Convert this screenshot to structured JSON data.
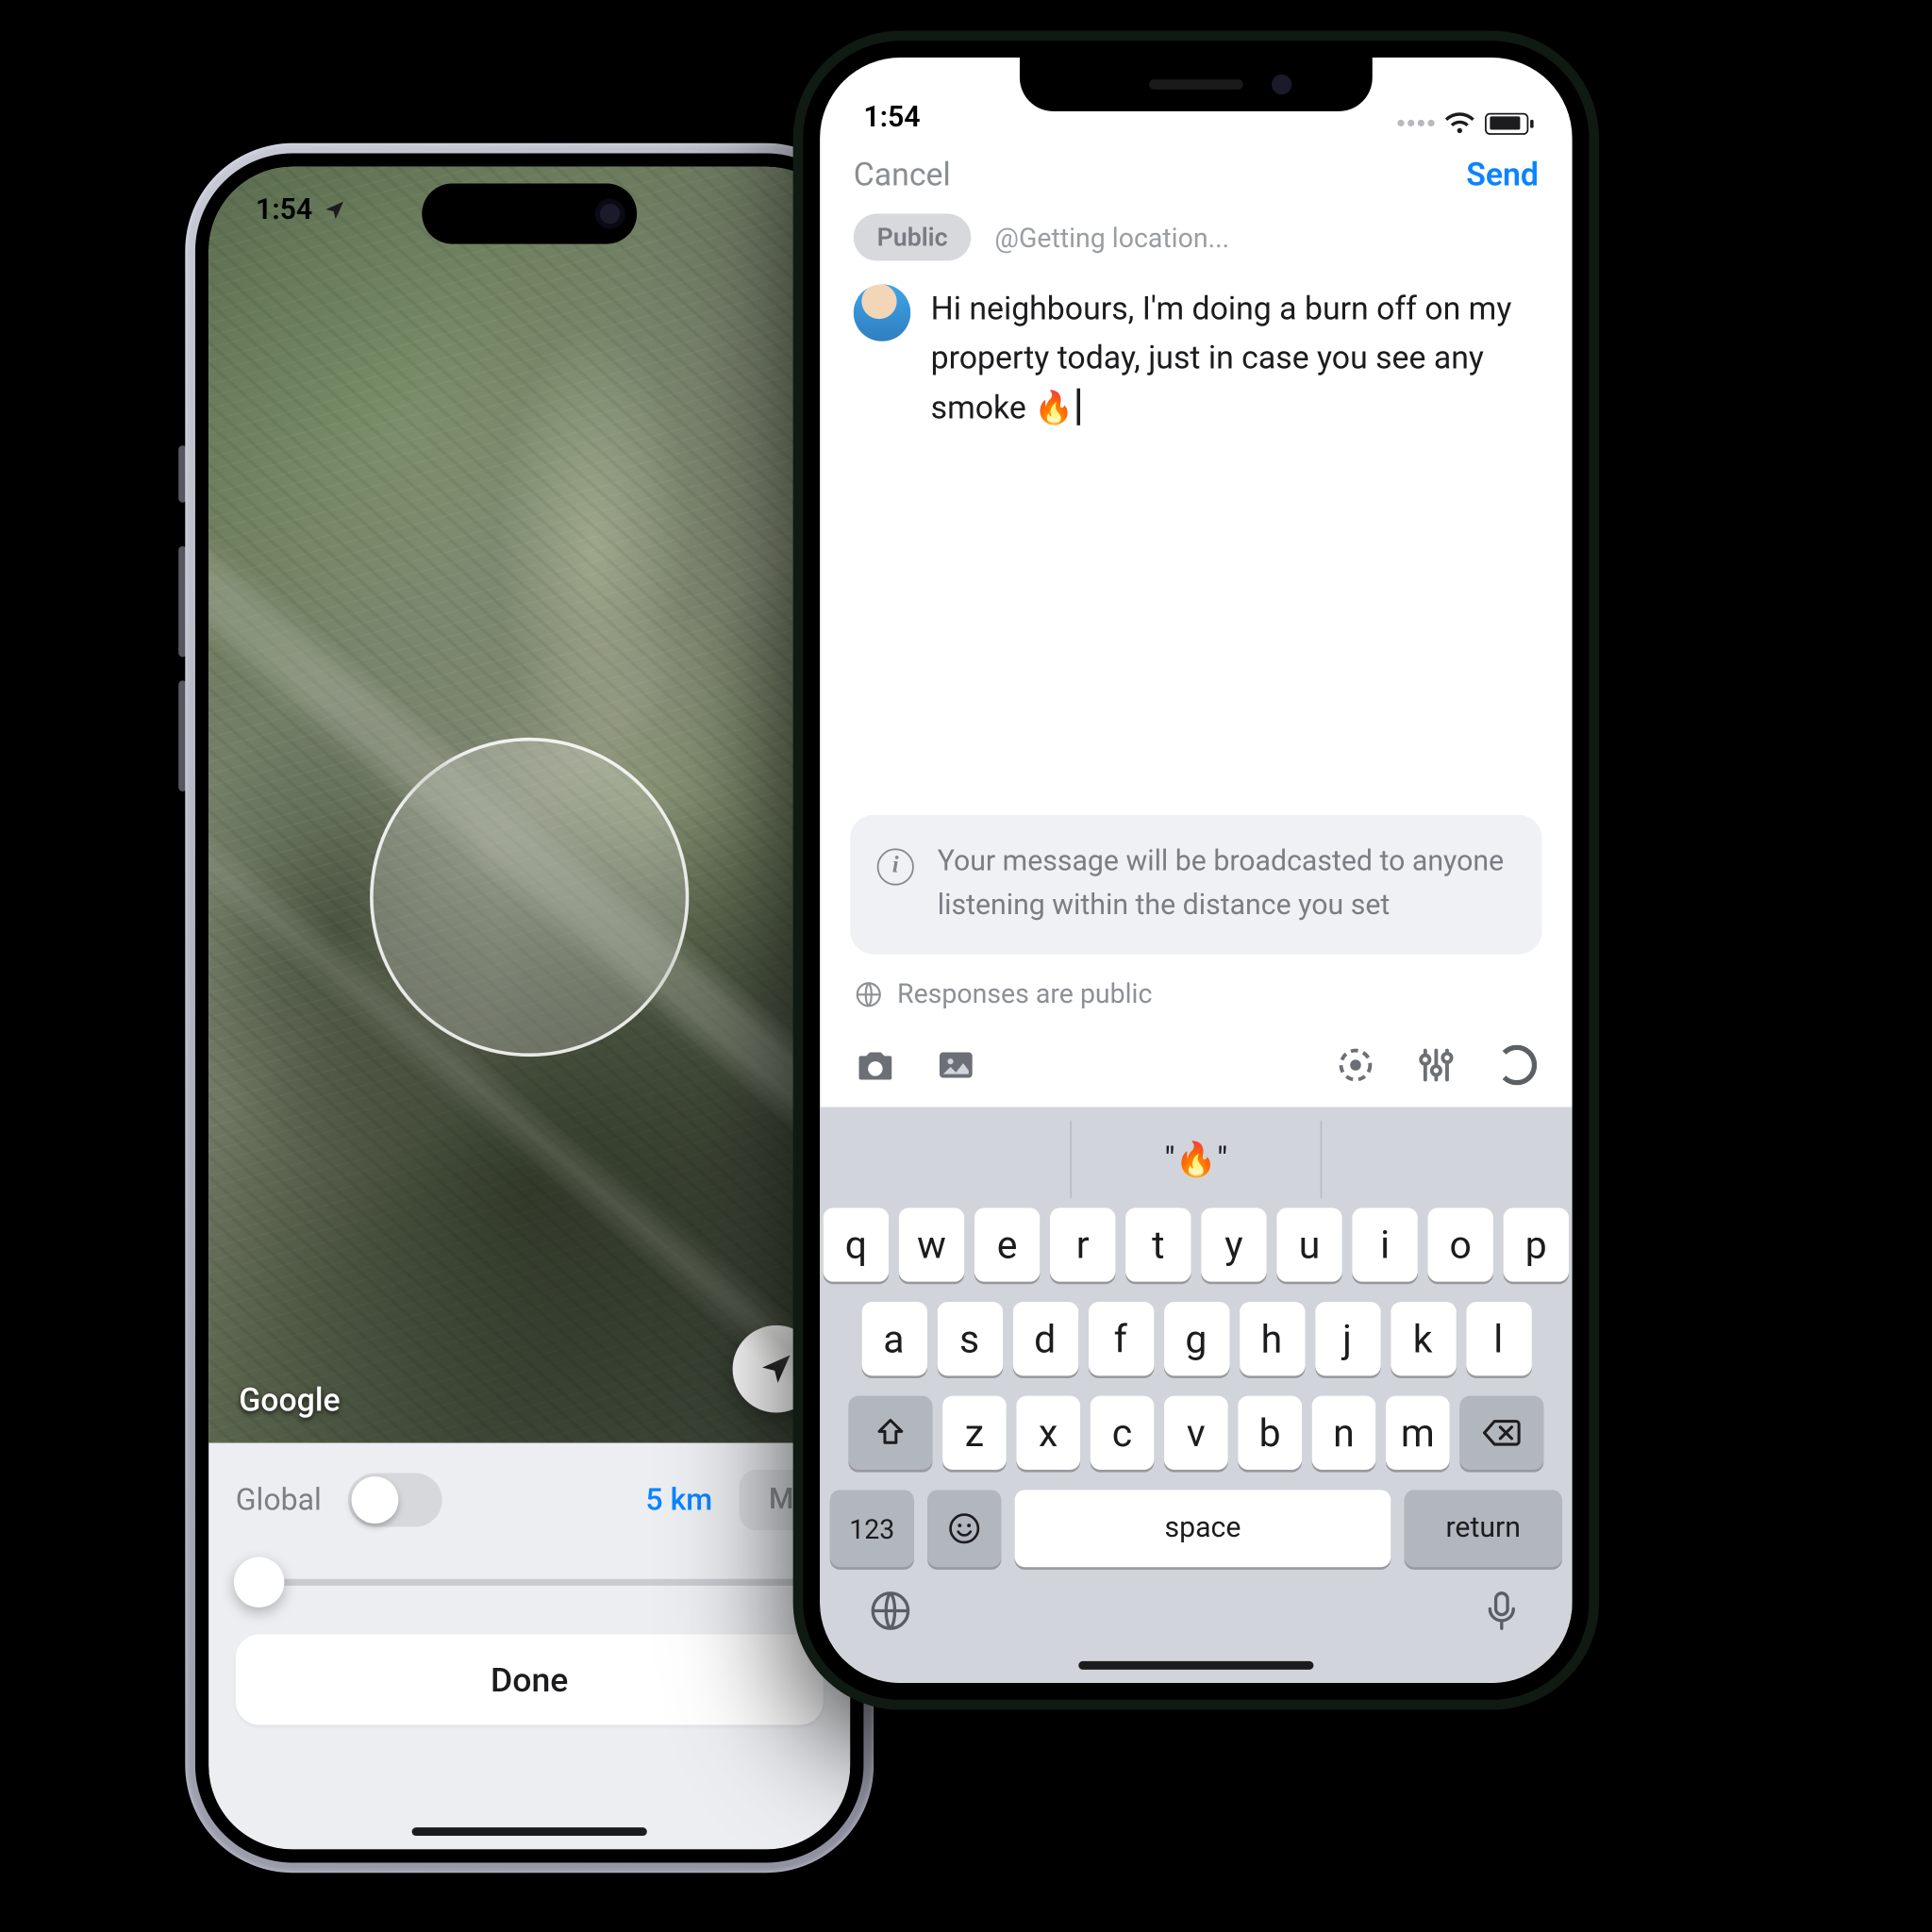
{
  "phoneA": {
    "status_time": "1:54",
    "map_attribution": "Google",
    "panel": {
      "global_label": "Global",
      "global_on": false,
      "distance": "5 km",
      "segment_label": "M",
      "done_label": "Done"
    }
  },
  "phoneB": {
    "status_time": "1:54",
    "nav": {
      "cancel": "Cancel",
      "send": "Send"
    },
    "chip_label": "Public",
    "location_text": "@Getting location...",
    "message": "Hi neighbours, I'm doing a burn off on my property today, just in case you see any smoke 🔥",
    "info_text": "Your message will be broadcasted to anyone listening within the distance you set",
    "responses_label": "Responses are public",
    "keyboard": {
      "suggestions": [
        "",
        "\"🔥\"",
        ""
      ],
      "row1": [
        "q",
        "w",
        "e",
        "r",
        "t",
        "y",
        "u",
        "i",
        "o",
        "p"
      ],
      "row2": [
        "a",
        "s",
        "d",
        "f",
        "g",
        "h",
        "j",
        "k",
        "l"
      ],
      "row3": [
        "z",
        "x",
        "c",
        "v",
        "b",
        "n",
        "m"
      ],
      "numkey": "123",
      "space": "space",
      "return": "return"
    }
  }
}
